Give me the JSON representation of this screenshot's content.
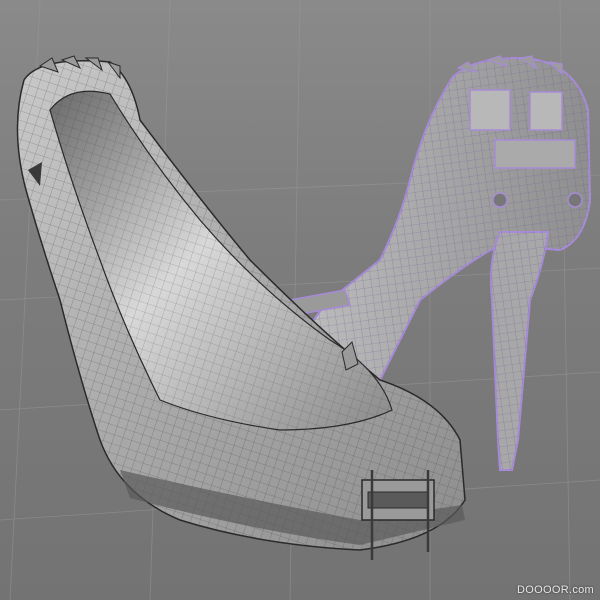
{
  "viewport": {
    "background": "#7d7d7d",
    "grid_color": "#9a9a9a",
    "mesh_color": "#2a2a2a",
    "shoe_surface": "#b4b4b4",
    "selection_color": "#a78bd8"
  },
  "watermark": {
    "text": "DOOOOR.com"
  }
}
